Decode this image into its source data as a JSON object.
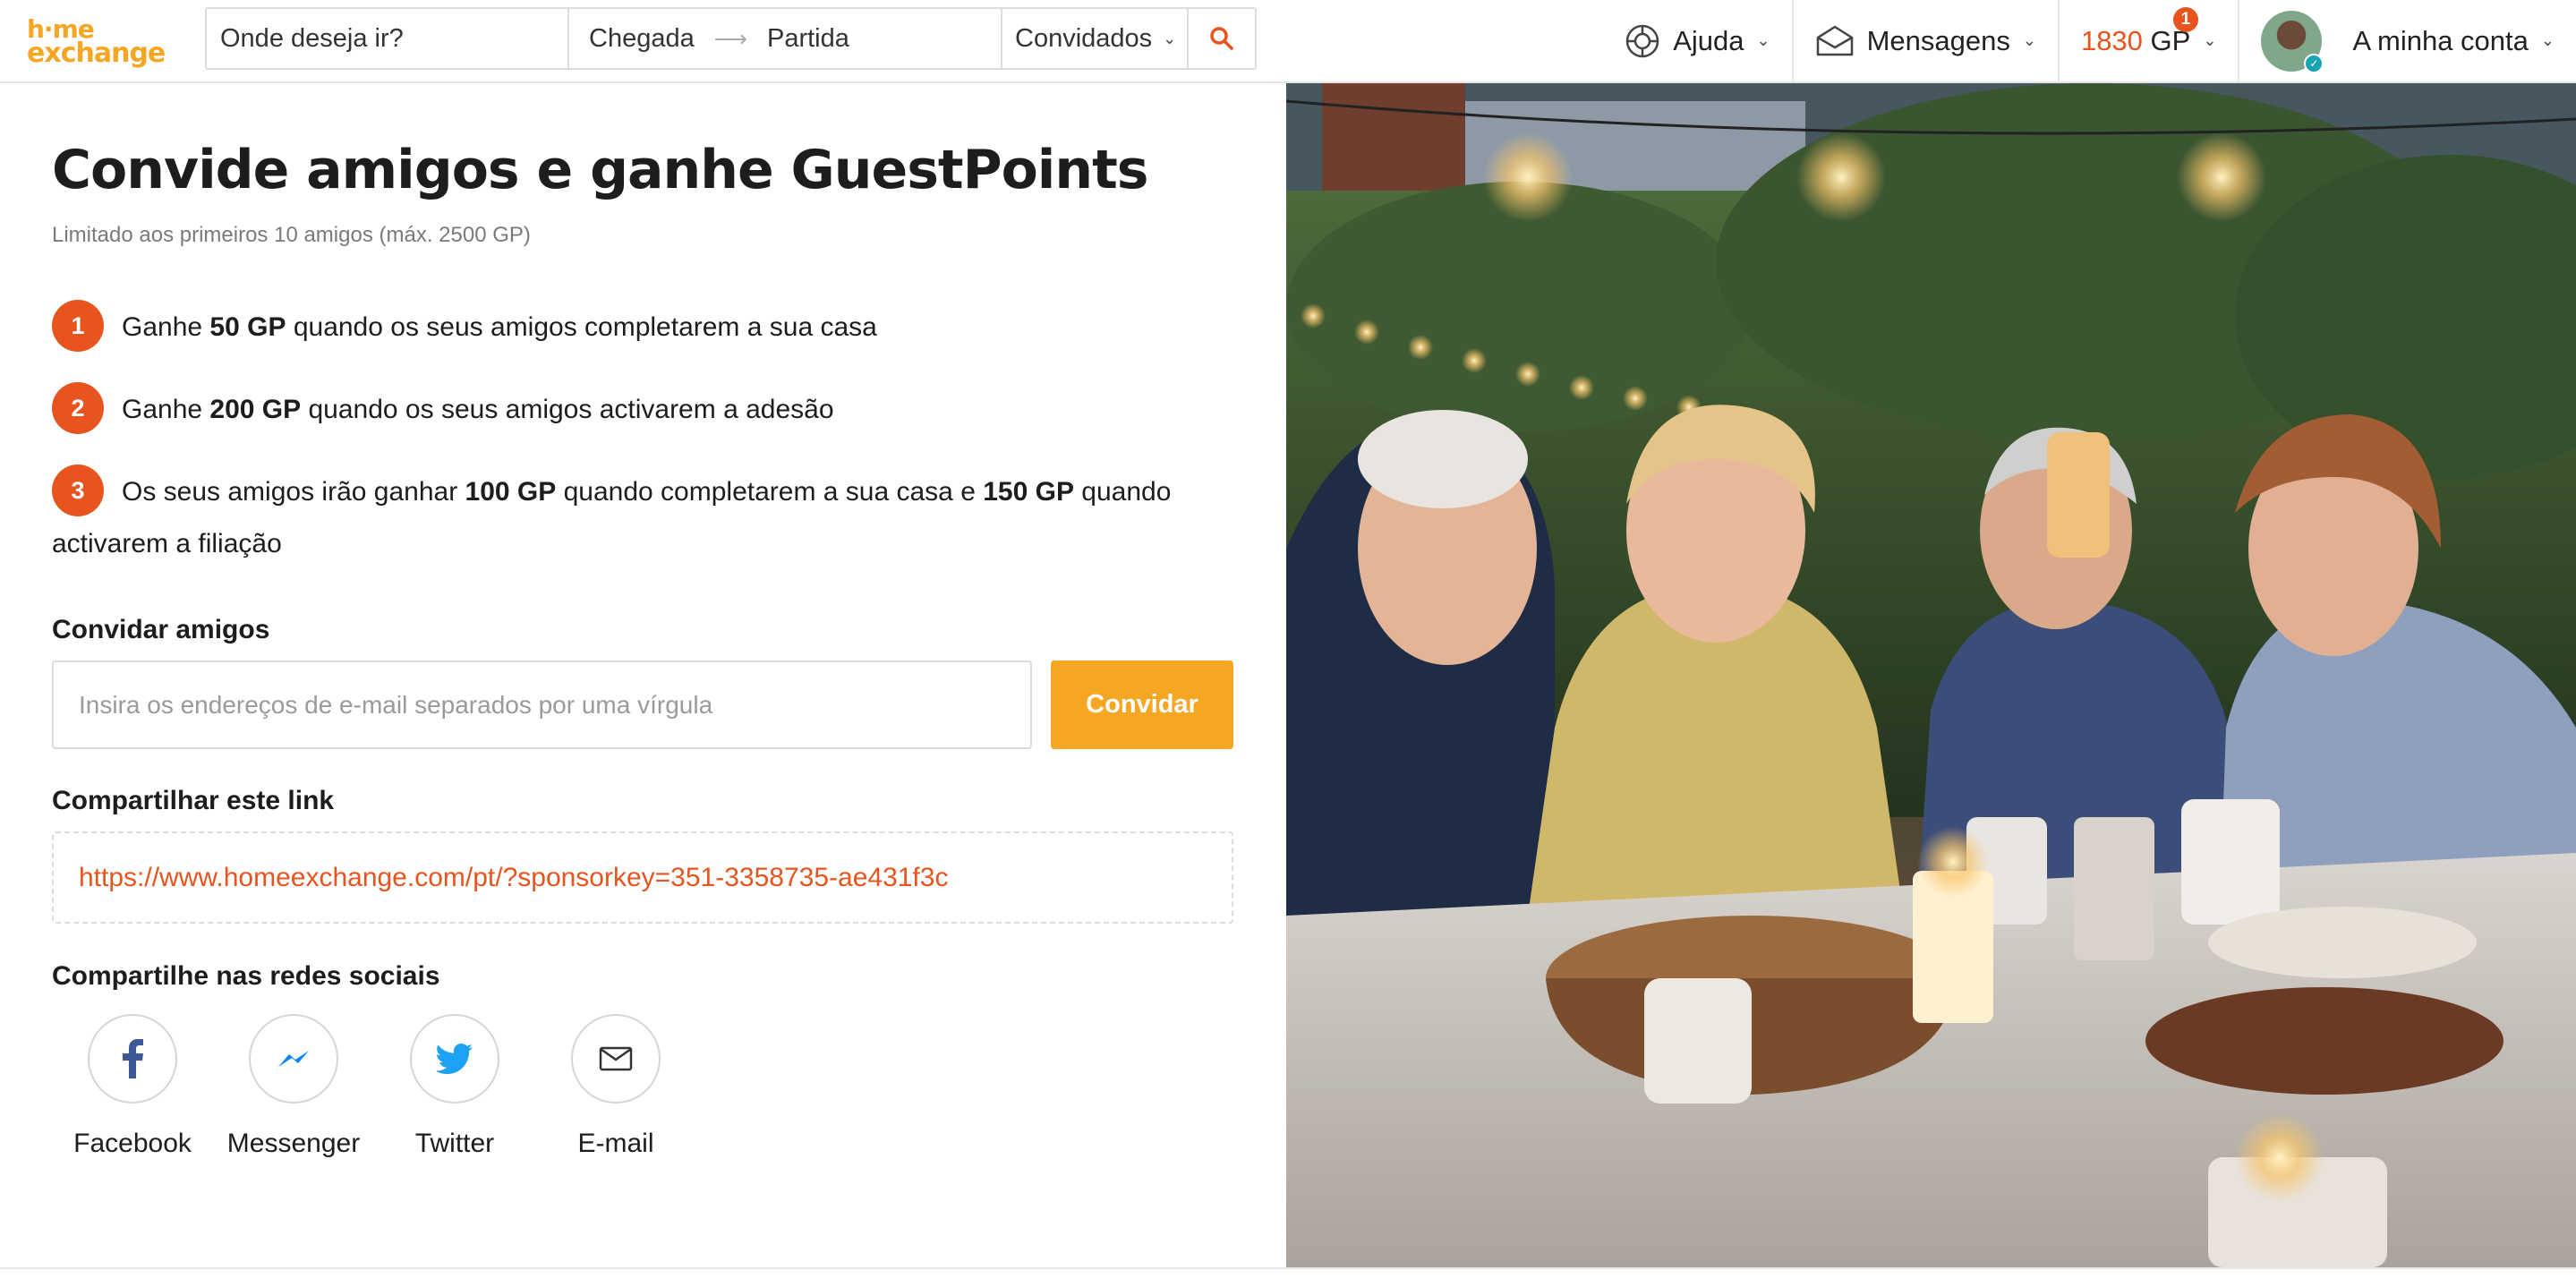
{
  "logo": {
    "line1": "h·me",
    "line2": "exchange"
  },
  "search": {
    "where_placeholder": "Onde deseja ir?",
    "checkin": "Chegada",
    "checkout": "Partida",
    "guests": "Convidados"
  },
  "nav": {
    "help": "Ajuda",
    "messages": "Mensagens",
    "gp_amount": "1830",
    "gp_unit": "GP",
    "gp_badge": "1",
    "account": "A minha conta"
  },
  "main": {
    "title": "Convide amigos e ganhe GuestPoints",
    "subtitle": "Limitado aos primeiros 10 amigos (máx. 2500 GP)",
    "steps": [
      {
        "num": "1",
        "pre": "Ganhe ",
        "bold1": "50 GP",
        "post": " quando os seus amigos completarem a sua casa"
      },
      {
        "num": "2",
        "pre": "Ganhe ",
        "bold1": "200 GP",
        "post": " quando os seus amigos activarem a adesão"
      },
      {
        "num": "3",
        "pre": "Os seus amigos irão ganhar ",
        "bold1": "100 GP",
        "mid": " quando completarem a sua casa e ",
        "bold2": "150 GP",
        "post": " quando activarem a filiação"
      }
    ],
    "invite_label": "Convidar amigos",
    "email_placeholder": "Insira os endereços de e-mail separados por uma vírgula",
    "invite_button": "Convidar",
    "share_link_label": "Compartilhar este link",
    "share_link": "https://www.homeexchange.com/pt/?sponsorkey=351-3358735-ae431f3c",
    "social_label": "Compartilhe nas redes sociais",
    "social": [
      {
        "name": "Facebook",
        "icon": "facebook-icon"
      },
      {
        "name": "Messenger",
        "icon": "messenger-icon"
      },
      {
        "name": "Twitter",
        "icon": "twitter-icon"
      },
      {
        "name": "E-mail",
        "icon": "envelope-icon"
      }
    ]
  },
  "colors": {
    "accent": "#e8541e",
    "brand": "#f5a623",
    "facebook": "#3b5998",
    "messenger": "#0084ff",
    "twitter": "#1da1f2"
  }
}
